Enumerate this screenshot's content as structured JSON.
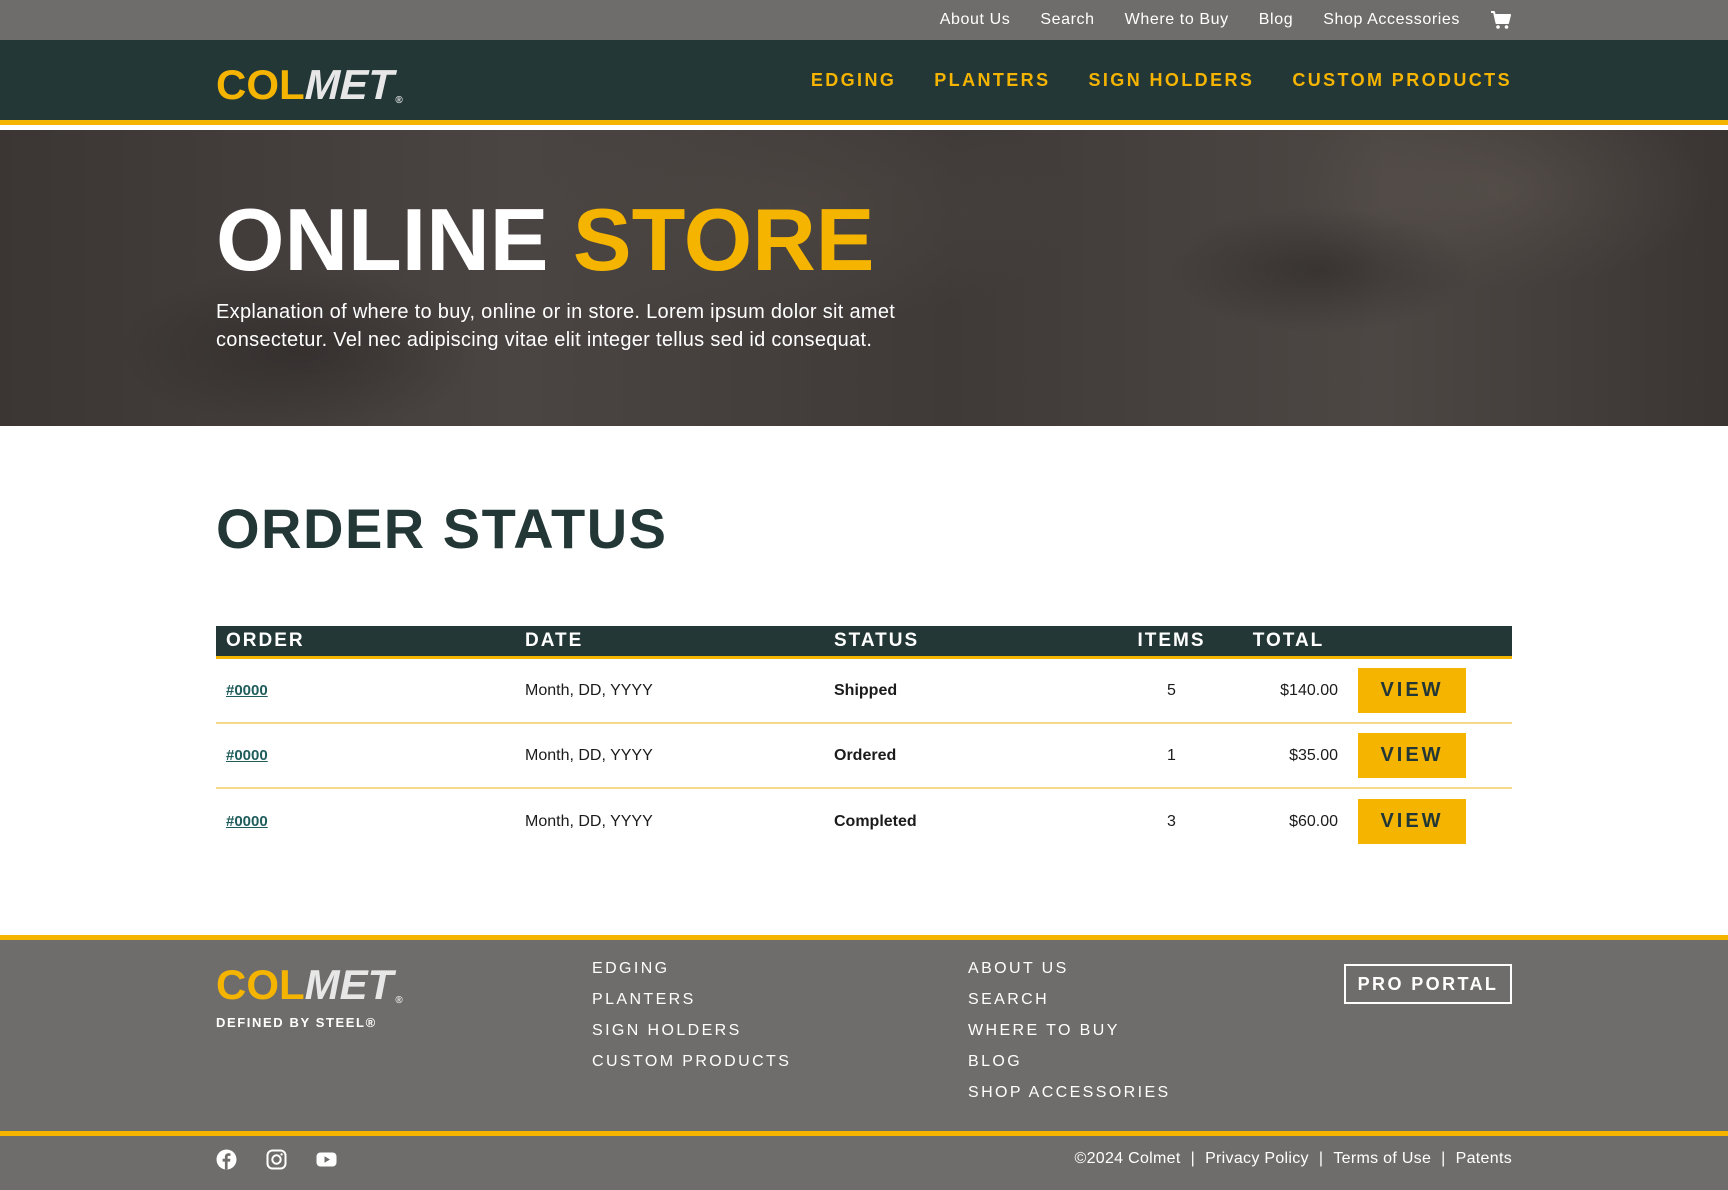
{
  "utility_nav": {
    "links": [
      "About Us",
      "Search",
      "Where to Buy",
      "Blog",
      "Shop Accessories"
    ],
    "cart_icon": "cart-icon"
  },
  "brand": {
    "logo_part1": "COL",
    "logo_part2": "MET",
    "logo_reg": "®",
    "tagline": "DEFINED BY STEEL®",
    "accent_color": "#f4b400",
    "dark_color": "#233737",
    "gray_color": "#6e6d6b"
  },
  "main_nav": {
    "links": [
      "EDGING",
      "PLANTERS",
      "SIGN HOLDERS",
      "CUSTOM PRODUCTS"
    ]
  },
  "hero": {
    "title_white": "ONLINE",
    "title_yellow": "STORE",
    "description": "Explanation of where to buy, online or in store. Lorem ipsum dolor sit amet consectetur. Vel nec adipiscing vitae elit integer tellus sed id consequat."
  },
  "order_status": {
    "title": "ORDER STATUS",
    "columns": [
      "ORDER",
      "DATE",
      "STATUS",
      "ITEMS",
      "TOTAL"
    ],
    "rows": [
      {
        "order": "#0000",
        "date": "Month, DD, YYYY",
        "status": "Shipped",
        "items": "5",
        "total": "$140.00",
        "action": "VIEW"
      },
      {
        "order": "#0000",
        "date": "Month, DD, YYYY",
        "status": "Ordered",
        "items": "1",
        "total": "$35.00",
        "action": "VIEW"
      },
      {
        "order": "#0000",
        "date": "Month, DD, YYYY",
        "status": "Completed",
        "items": "3",
        "total": "$60.00",
        "action": "VIEW"
      }
    ]
  },
  "footer": {
    "col1": [
      "EDGING",
      "PLANTERS",
      "SIGN HOLDERS",
      "CUSTOM PRODUCTS"
    ],
    "col2": [
      "ABOUT US",
      "SEARCH",
      "WHERE TO BUY",
      "BLOG",
      "SHOP ACCESSORIES"
    ],
    "pro_portal": "PRO PORTAL",
    "social_icons": [
      "facebook-icon",
      "instagram-icon",
      "youtube-icon"
    ],
    "copyright": "©2024 Colmet",
    "legal_links": [
      "Privacy Policy",
      "Terms of Use",
      "Patents"
    ]
  }
}
